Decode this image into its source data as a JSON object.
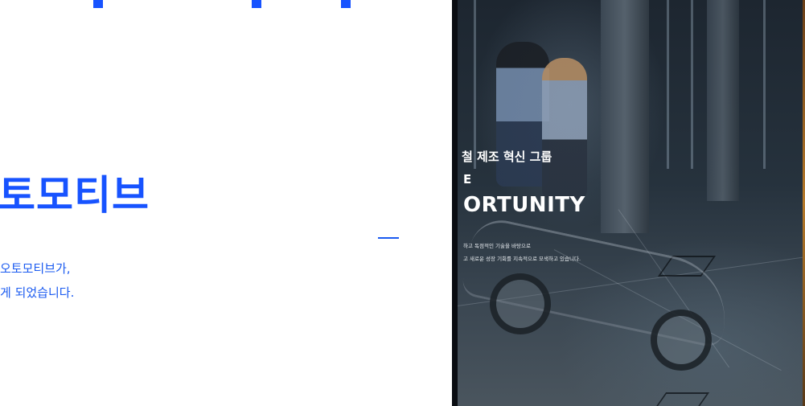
{
  "left_panel": {
    "heading": "토모티브",
    "description_lines": [
      "오토모티브가,",
      "게 되었습니다."
    ],
    "accent_color": "#1753ff"
  },
  "photo_panel": {
    "headline_kr": "철 제조 혁신 그룹",
    "line_e": "E",
    "headline_en": "ORTUNITY",
    "small_lines": [
      "하고 독점적인 기술을 바탕으로",
      "고 새로운 성장 기회를 지속적으로 모색하고 있습니다."
    ]
  }
}
